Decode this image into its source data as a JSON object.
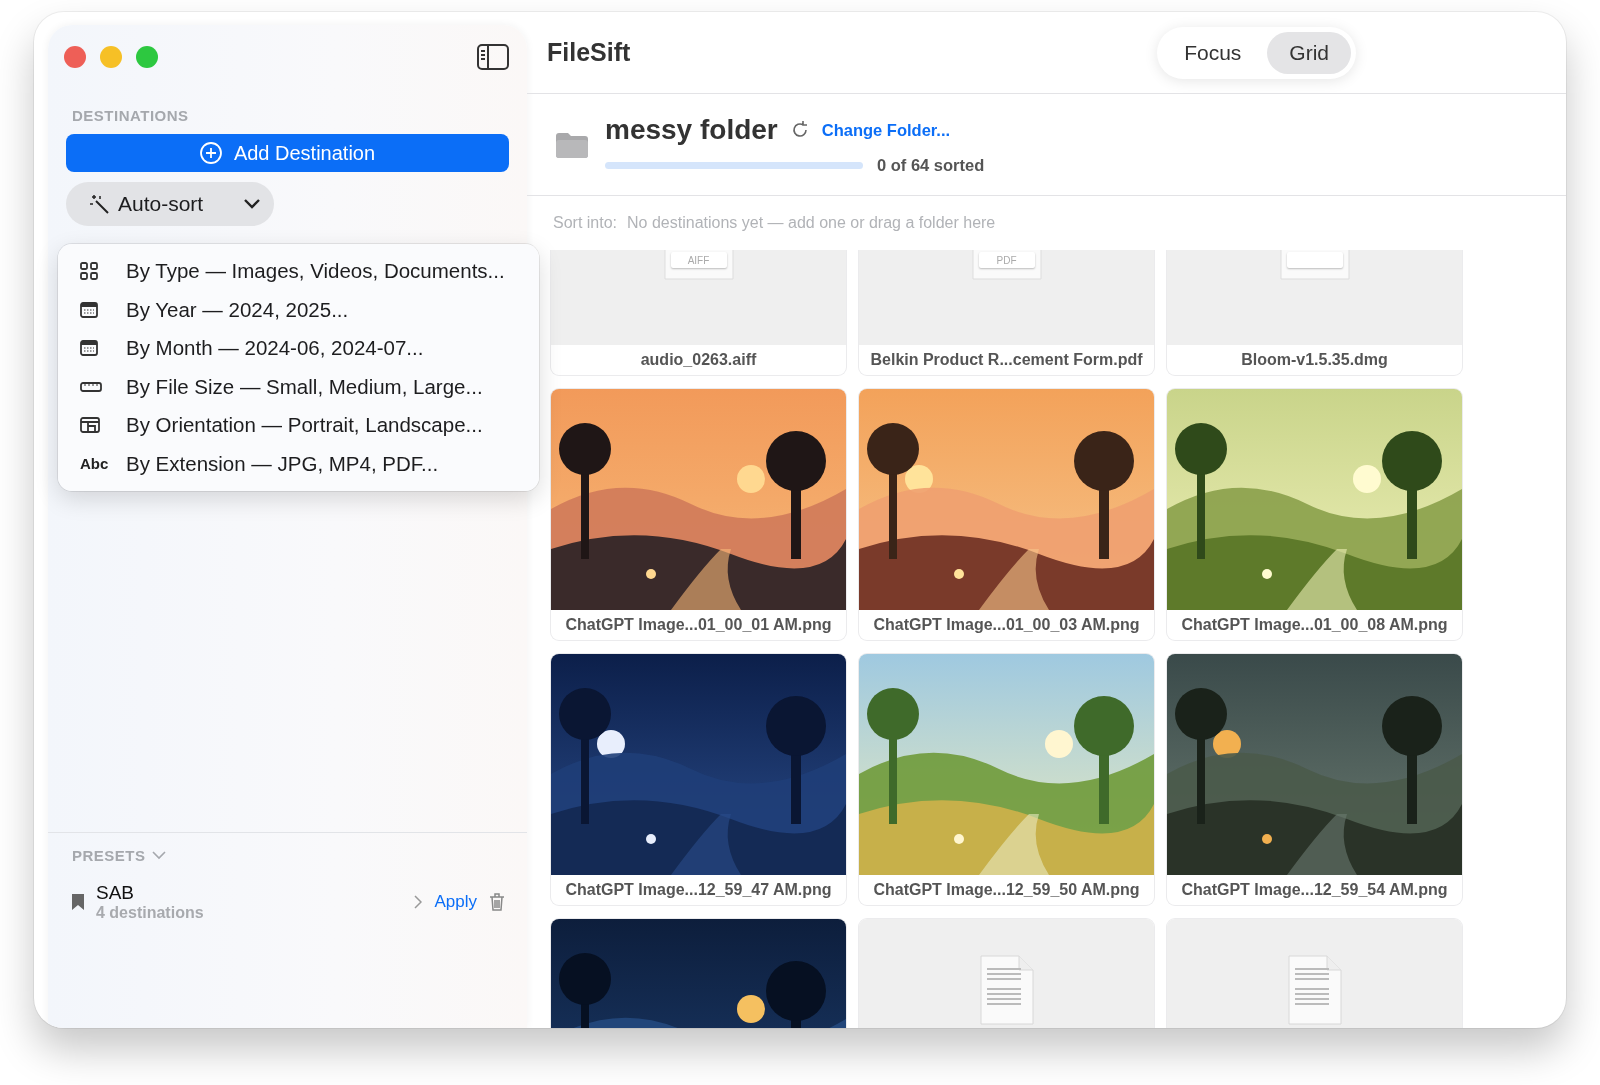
{
  "sidebar": {
    "section_title": "DESTINATIONS",
    "add_button": "Add Destination",
    "autosort": {
      "label": "Auto-sort",
      "expanded": true
    },
    "menu": [
      {
        "label": "By Type — Images, Videos, Documents..."
      },
      {
        "label": "By Year — 2024, 2025..."
      },
      {
        "label": "By Month — 2024-06, 2024-07..."
      },
      {
        "label": "By File Size — Small, Medium, Large..."
      },
      {
        "label": "By Orientation — Portrait, Landscape..."
      },
      {
        "label": "By Extension — JPG, MP4, PDF...",
        "glyph": "Abc"
      }
    ],
    "presets": {
      "title": "PRESETS",
      "items": [
        {
          "name": "SAB",
          "detail": "4 destinations",
          "action": "Apply"
        }
      ]
    }
  },
  "app_title": "FileSift",
  "view_tabs": [
    {
      "label": "Focus",
      "selected": false
    },
    {
      "label": "Grid",
      "selected": true
    }
  ],
  "folder": {
    "name": "messy folder",
    "change": "Change Folder...",
    "progress": {
      "level": 0
    },
    "status": "0 of 64 sorted"
  },
  "sort_into": {
    "label": "Sort into:",
    "hint": "No destinations yet — add one or drag a folder here"
  },
  "files": [
    {
      "kind": "file",
      "name": "audio_0263.aiff",
      "badge": "AIFF"
    },
    {
      "kind": "file",
      "name": "Belkin Product R...cement Form.pdf",
      "badge": "PDF"
    },
    {
      "kind": "file",
      "name": "Bloom-v1.5.35.dmg"
    },
    {
      "kind": "picture",
      "name": "ChatGPT Image...01_00_01 AM.png"
    },
    {
      "kind": "picture",
      "name": "ChatGPT Image...01_00_03 AM.png"
    },
    {
      "kind": "picture",
      "name": "ChatGPT Image...01_00_08 AM.png"
    },
    {
      "kind": "picture",
      "name": "ChatGPT Image...12_59_47 AM.png"
    },
    {
      "kind": "picture",
      "name": "ChatGPT Image...12_59_50 AM.png"
    },
    {
      "kind": "picture",
      "name": "ChatGPT Image...12_59_54 AM.png"
    },
    {
      "kind": "picture"
    },
    {
      "kind": "document"
    },
    {
      "kind": "document"
    }
  ]
}
